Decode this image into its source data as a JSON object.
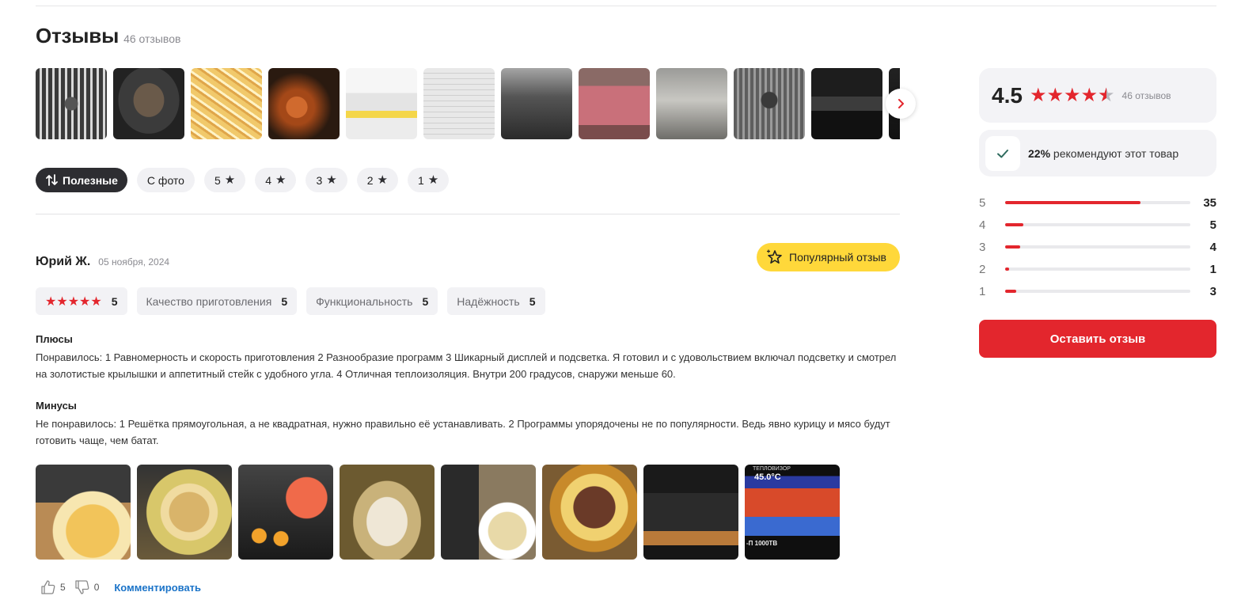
{
  "header": {
    "title": "Отзывы",
    "count": "46 отзывов"
  },
  "gallery": {
    "thumbs": [
      {
        "style": "grate"
      },
      {
        "style": "basket"
      },
      {
        "style": "fries"
      },
      {
        "style": "meat"
      },
      {
        "style": "box"
      },
      {
        "style": "manual"
      },
      {
        "style": "fryer-dark"
      },
      {
        "style": "pink"
      },
      {
        "style": "steel"
      },
      {
        "style": "grill"
      },
      {
        "style": "fryer-black"
      },
      {
        "style": "partial"
      }
    ],
    "next_icon": "chevron-right-icon"
  },
  "filters": [
    {
      "label": "Полезные",
      "active": true,
      "icon": "sort-icon"
    },
    {
      "label": "С фото",
      "active": false
    },
    {
      "label": "5",
      "star": true
    },
    {
      "label": "4",
      "star": true
    },
    {
      "label": "3",
      "star": true
    },
    {
      "label": "2",
      "star": true
    },
    {
      "label": "1",
      "star": true
    }
  ],
  "review": {
    "author": "Юрий Ж.",
    "date": "05 ноября, 2024",
    "badge": "Популярный отзыв",
    "overall": "5",
    "scores": [
      {
        "label": "Качество приготовления",
        "value": "5"
      },
      {
        "label": "Функциональность",
        "value": "5"
      },
      {
        "label": "Надёжность",
        "value": "5"
      }
    ],
    "pros_title": "Плюсы",
    "pros_text": "Понравилось: 1 Равномерность и скорость приготовления 2 Разнообразие программ 3 Шикарный дисплей и подсветка. Я готовил и с удовольствием включал подсветку и смотрел на золотистые крылышки и аппетитный стейк с удобного угла. 4 Отличная теплоизоляция. Внутри 200 градусов, снаружи меньше 60.",
    "cons_title": "Минусы",
    "cons_text": "Не понравилось: 1 Решётка прямоугольная, а не квадратная, нужно правильно её устанавливать. 2 Программы упорядочены не по популярности. Ведь явно курицу и мясо будут готовить чаще, чем батат.",
    "photos": [
      {
        "style": "fries-plate"
      },
      {
        "style": "bread"
      },
      {
        "style": "eggs"
      },
      {
        "style": "dish"
      },
      {
        "style": "fryer-plate"
      },
      {
        "style": "steak"
      },
      {
        "style": "fryer-front"
      },
      {
        "style": "thermal",
        "overlay_top": "ТЕПЛОВИЗОР",
        "overlay_temp": "45.0°C",
        "overlay_bottom": "-П 1000ТВ"
      }
    ],
    "likes": "5",
    "dislikes": "0",
    "comment_label": "Комментировать"
  },
  "summary": {
    "rating": "4.5",
    "rating_value": 4.5,
    "count": "46 отзывов",
    "recommend_percent": "22%",
    "recommend_text": "рекомендуют этот товар",
    "distribution": [
      {
        "stars": "5",
        "count": "35",
        "share": 0.73
      },
      {
        "stars": "4",
        "count": "5",
        "share": 0.1
      },
      {
        "stars": "3",
        "count": "4",
        "share": 0.08
      },
      {
        "stars": "2",
        "count": "1",
        "share": 0.02
      },
      {
        "stars": "1",
        "count": "3",
        "share": 0.06
      }
    ],
    "leave_button": "Оставить отзыв"
  },
  "colors": {
    "accent": "#e3262d",
    "badge": "#ffd83a",
    "link": "#1a73c8",
    "dark_chip": "#2d2d31"
  }
}
